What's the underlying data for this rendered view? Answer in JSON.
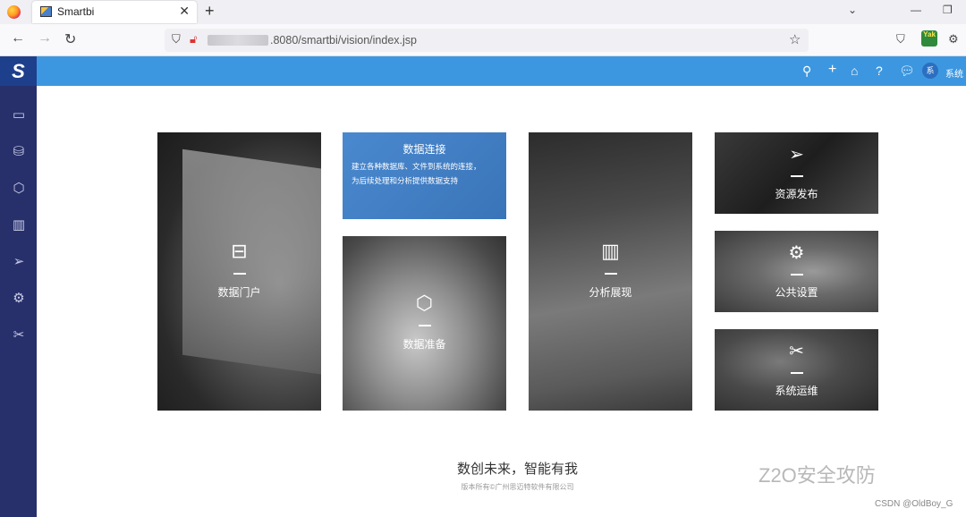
{
  "browser": {
    "tab_title": "Smartbi",
    "tab_close": "✕",
    "new_tab": "+",
    "url_suffix": ".8080/smartbi/vision/index.jsp",
    "ext_label": "Yak"
  },
  "header": {
    "logo": "S",
    "user_avatar": "系",
    "user_label": "系统"
  },
  "tiles": {
    "portal": "数据门户",
    "connect_title": "数据连接",
    "connect_desc_1": "建立各种数据库、文件到系统的连接，",
    "connect_desc_2": "为后续处理和分析提供数据支持",
    "prepare": "数据准备",
    "analysis": "分析展现",
    "publish": "资源发布",
    "settings": "公共设置",
    "ops": "系统运维"
  },
  "footer": {
    "slogan": "数创未来，智能有我",
    "copyright": "版本所有©广州思迈特软件有限公司"
  },
  "watermark": {
    "wechat": "Z2O安全攻防",
    "csdn": "CSDN @OldBoy_G"
  },
  "colors": {
    "header_blue": "#3d97e0",
    "sidebar": "#27306b",
    "connect_tile": "#3f7fc4"
  }
}
